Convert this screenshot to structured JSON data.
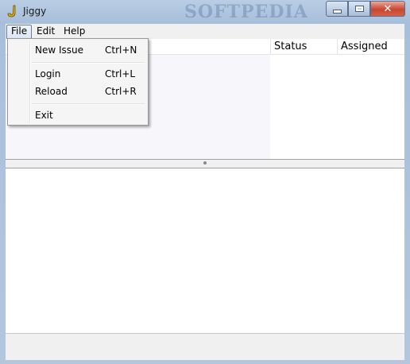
{
  "window": {
    "title": "Jiggy",
    "watermark": "SOFTPEDIA",
    "controls": {
      "close_glyph": "✕"
    }
  },
  "menubar": {
    "items": [
      {
        "label": "File"
      },
      {
        "label": "Edit"
      },
      {
        "label": "Help"
      }
    ]
  },
  "file_menu": {
    "items": [
      {
        "label": "New Issue",
        "shortcut": "Ctrl+N"
      },
      {
        "label": "Login",
        "shortcut": "Ctrl+L"
      },
      {
        "label": "Reload",
        "shortcut": "Ctrl+R"
      },
      {
        "label": "Exit",
        "shortcut": ""
      }
    ]
  },
  "issue_table": {
    "columns": [
      {
        "label": "Status"
      },
      {
        "label": "Assigned"
      }
    ]
  },
  "colors": {
    "frame": "#b3c6de",
    "close_button": "#c8472f",
    "menu_background": "#f5f5f5"
  }
}
